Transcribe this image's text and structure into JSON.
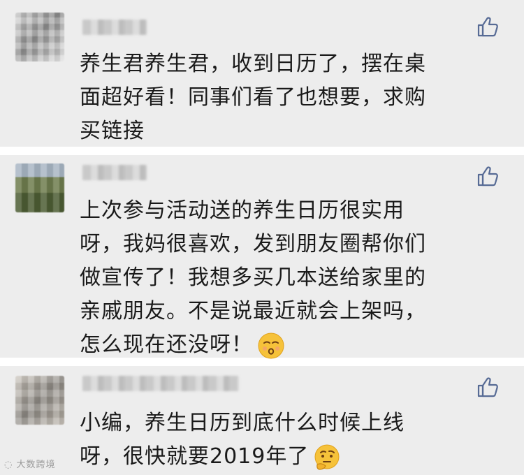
{
  "comments": [
    {
      "text": "养生君养生君，收到日历了，摆在桌\n面超好看！同事们看了也想要，求购\n买链接",
      "like_icon": "thumbs-up-icon"
    },
    {
      "text": "上次参与活动送的养生日历很实用\n呀，我妈很喜欢，发到朋友圈帮你们\n做宣传了！我想多买几本送给家里的\n亲戚朋友。不是说最近就会上架吗，\n怎么现在还没呀！",
      "emoji": "kissing-face-emoji",
      "like_icon": "thumbs-up-icon"
    },
    {
      "text": "小编，养生日历到底什么时候上线\n呀，很快就要2019年了",
      "emoji": "thinking-face-emoji",
      "like_icon": "thumbs-up-icon"
    }
  ],
  "watermark": "大数跨境",
  "colors": {
    "card_bg": "#ededed",
    "separator": "#ffffff",
    "text": "#1a1a1a",
    "like_icon": "#576b95"
  }
}
